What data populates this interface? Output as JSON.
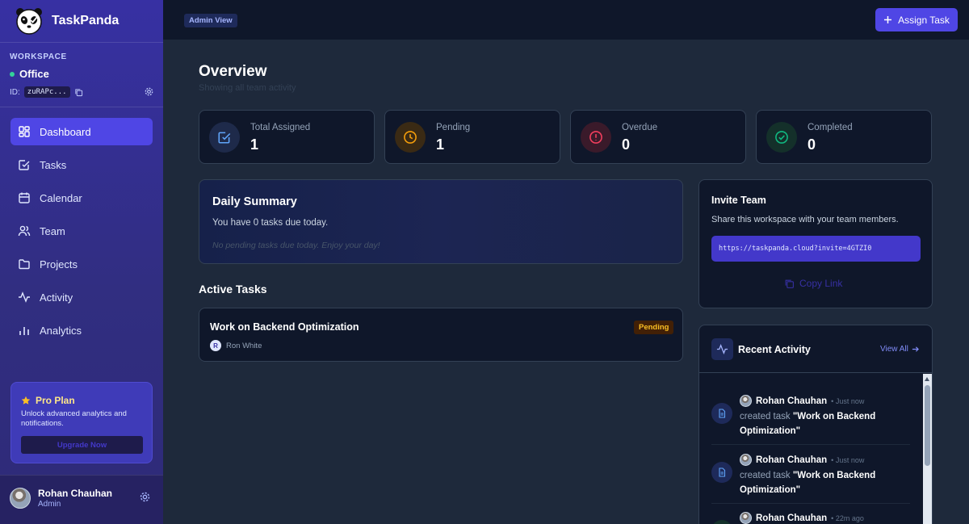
{
  "app": {
    "name": "TaskPanda"
  },
  "workspace": {
    "label": "WORKSPACE",
    "name": "Office",
    "id_label": "ID:",
    "id_value": "zuRAPc..."
  },
  "nav": [
    {
      "label": "Dashboard",
      "icon": "dashboard-icon",
      "active": true
    },
    {
      "label": "Tasks",
      "icon": "tasks-icon"
    },
    {
      "label": "Calendar",
      "icon": "calendar-icon"
    },
    {
      "label": "Team",
      "icon": "team-icon"
    },
    {
      "label": "Projects",
      "icon": "folder-icon"
    },
    {
      "label": "Activity",
      "icon": "activity-icon"
    },
    {
      "label": "Analytics",
      "icon": "analytics-icon"
    }
  ],
  "pro_plan": {
    "title": "Pro Plan",
    "description": "Unlock advanced analytics and notifications.",
    "button": "Upgrade Now"
  },
  "user": {
    "name": "Rohan Chauhan",
    "role": "Admin"
  },
  "topbar": {
    "badge": "Admin View",
    "assign_button": "Assign Task"
  },
  "overview": {
    "title": "Overview",
    "subtitle": "Showing all team activity"
  },
  "stats": [
    {
      "label": "Total Assigned",
      "value": "1",
      "color": "#60a5fa",
      "bg": "#1e2a4a"
    },
    {
      "label": "Pending",
      "value": "1",
      "color": "#f59e0b",
      "bg": "#3a2a14"
    },
    {
      "label": "Overdue",
      "value": "0",
      "color": "#f43f5e",
      "bg": "#3a1a2a"
    },
    {
      "label": "Completed",
      "value": "0",
      "color": "#10b981",
      "bg": "#14302a"
    }
  ],
  "daily_summary": {
    "title": "Daily Summary",
    "text": "You have 0 tasks due today.",
    "empty": "No pending tasks due today. Enjoy your day!"
  },
  "active_tasks": {
    "title": "Active Tasks",
    "items": [
      {
        "title": "Work on Backend Optimization",
        "status": "Pending",
        "assignee": "Ron White",
        "assignee_initial": "R"
      }
    ]
  },
  "invite": {
    "title": "Invite Team",
    "description": "Share this workspace with your team members.",
    "link": "https://taskpanda.cloud?invite=4GTZI0",
    "copy_label": "Copy Link"
  },
  "recent_activity": {
    "title": "Recent Activity",
    "view_all": "View All",
    "items": [
      {
        "user": "Rohan Chauhan",
        "time": "• Just now",
        "action": "created task",
        "target": "\"Work on Backend Optimization\""
      },
      {
        "user": "Rohan Chauhan",
        "time": "• Just now",
        "action": "created task",
        "target": "\"Work on Backend Optimization\""
      },
      {
        "user": "Rohan Chauhan",
        "time": "• 22m ago",
        "action": "",
        "target": ""
      }
    ]
  }
}
